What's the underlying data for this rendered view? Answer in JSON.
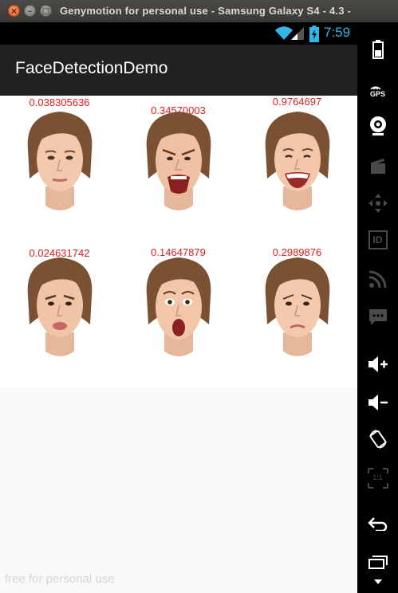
{
  "window": {
    "title": "Genymotion for personal use - Samsung Galaxy S4 - 4.3 -"
  },
  "status_bar": {
    "time": "7:59"
  },
  "app": {
    "title": "FaceDetectionDemo"
  },
  "faces": [
    {
      "score": "0.038305636",
      "expression": "neutral"
    },
    {
      "score": "0.34570003",
      "expression": "angry shouting"
    },
    {
      "score": "0.9764697",
      "expression": "big smile"
    },
    {
      "score": "0.024631742",
      "expression": "pouting sad"
    },
    {
      "score": "0.14647879",
      "expression": "surprised"
    },
    {
      "score": "0.2989876",
      "expression": "sad"
    }
  ],
  "watermark": "free for personal use",
  "toolbar": {
    "items": [
      "battery-icon",
      "gps-icon",
      "webcam-icon",
      "screencast-icon",
      "dpad-icon",
      "id-icon",
      "rss-icon",
      "sms-icon",
      "volume-up-icon",
      "volume-down-icon",
      "rotate-icon",
      "scale-icon",
      "back-icon",
      "recent-apps-icon"
    ],
    "gps_label": "GPS",
    "id_label": "ID",
    "scale_label": "1:1"
  },
  "colors": {
    "accent": "#33b5e5",
    "score_text": "#e02020",
    "action_bar": "#212121"
  }
}
